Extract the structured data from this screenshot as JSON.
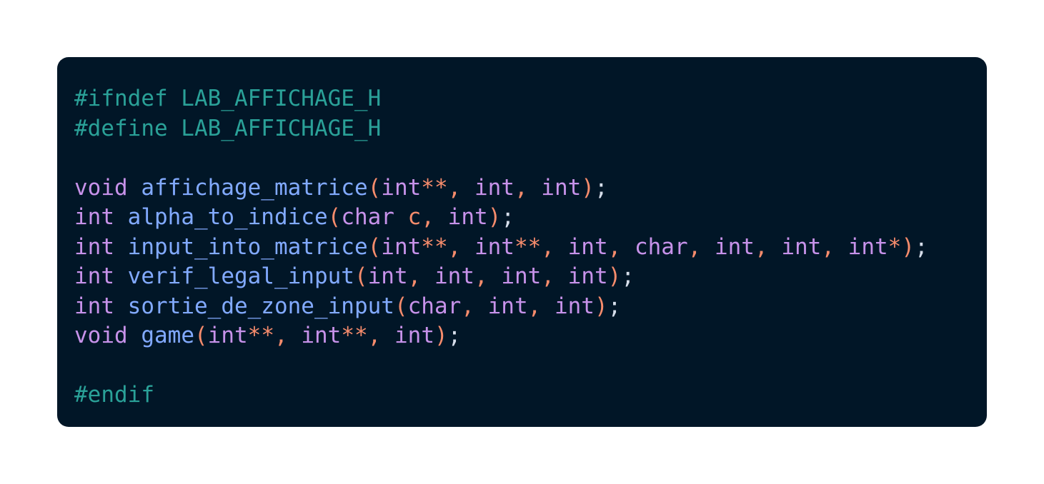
{
  "colors": {
    "page_background": "#ffffff",
    "card_background": "#011627",
    "preprocessor": "#2aa198",
    "keyword": "#c792ea",
    "function": "#82aaff",
    "operator": "#f78c6c",
    "punctuation": "#d6deeb"
  },
  "code": {
    "language": "c",
    "lines": [
      [
        {
          "t": "preproc",
          "v": "#ifndef LAB_AFFICHAGE_H"
        }
      ],
      [
        {
          "t": "preproc",
          "v": "#define LAB_AFFICHAGE_H"
        }
      ],
      [],
      [
        {
          "t": "keyword",
          "v": "void"
        },
        {
          "t": "space",
          "v": " "
        },
        {
          "t": "func",
          "v": "affichage_matrice"
        },
        {
          "t": "paren",
          "v": "("
        },
        {
          "t": "keyword",
          "v": "int"
        },
        {
          "t": "op",
          "v": "**"
        },
        {
          "t": "op",
          "v": ","
        },
        {
          "t": "space",
          "v": " "
        },
        {
          "t": "keyword",
          "v": "int"
        },
        {
          "t": "op",
          "v": ","
        },
        {
          "t": "space",
          "v": " "
        },
        {
          "t": "keyword",
          "v": "int"
        },
        {
          "t": "paren",
          "v": ")"
        },
        {
          "t": "punct",
          "v": ";"
        }
      ],
      [
        {
          "t": "keyword",
          "v": "int"
        },
        {
          "t": "space",
          "v": " "
        },
        {
          "t": "func",
          "v": "alpha_to_indice"
        },
        {
          "t": "paren",
          "v": "("
        },
        {
          "t": "keyword",
          "v": "char"
        },
        {
          "t": "space",
          "v": " "
        },
        {
          "t": "ident",
          "v": "c"
        },
        {
          "t": "op",
          "v": ","
        },
        {
          "t": "space",
          "v": " "
        },
        {
          "t": "keyword",
          "v": "int"
        },
        {
          "t": "paren",
          "v": ")"
        },
        {
          "t": "punct",
          "v": ";"
        }
      ],
      [
        {
          "t": "keyword",
          "v": "int"
        },
        {
          "t": "space",
          "v": " "
        },
        {
          "t": "func",
          "v": "input_into_matrice"
        },
        {
          "t": "paren",
          "v": "("
        },
        {
          "t": "keyword",
          "v": "int"
        },
        {
          "t": "op",
          "v": "**"
        },
        {
          "t": "op",
          "v": ","
        },
        {
          "t": "space",
          "v": " "
        },
        {
          "t": "keyword",
          "v": "int"
        },
        {
          "t": "op",
          "v": "**"
        },
        {
          "t": "op",
          "v": ","
        },
        {
          "t": "space",
          "v": " "
        },
        {
          "t": "keyword",
          "v": "int"
        },
        {
          "t": "op",
          "v": ","
        },
        {
          "t": "space",
          "v": " "
        },
        {
          "t": "keyword",
          "v": "char"
        },
        {
          "t": "op",
          "v": ","
        },
        {
          "t": "space",
          "v": " "
        },
        {
          "t": "keyword",
          "v": "int"
        },
        {
          "t": "op",
          "v": ","
        },
        {
          "t": "space",
          "v": " "
        },
        {
          "t": "keyword",
          "v": "int"
        },
        {
          "t": "op",
          "v": ","
        },
        {
          "t": "space",
          "v": " "
        },
        {
          "t": "keyword",
          "v": "int"
        },
        {
          "t": "op",
          "v": "*"
        },
        {
          "t": "paren",
          "v": ")"
        },
        {
          "t": "punct",
          "v": ";"
        }
      ],
      [
        {
          "t": "keyword",
          "v": "int"
        },
        {
          "t": "space",
          "v": " "
        },
        {
          "t": "func",
          "v": "verif_legal_input"
        },
        {
          "t": "paren",
          "v": "("
        },
        {
          "t": "keyword",
          "v": "int"
        },
        {
          "t": "op",
          "v": ","
        },
        {
          "t": "space",
          "v": " "
        },
        {
          "t": "keyword",
          "v": "int"
        },
        {
          "t": "op",
          "v": ","
        },
        {
          "t": "space",
          "v": " "
        },
        {
          "t": "keyword",
          "v": "int"
        },
        {
          "t": "op",
          "v": ","
        },
        {
          "t": "space",
          "v": " "
        },
        {
          "t": "keyword",
          "v": "int"
        },
        {
          "t": "paren",
          "v": ")"
        },
        {
          "t": "punct",
          "v": ";"
        }
      ],
      [
        {
          "t": "keyword",
          "v": "int"
        },
        {
          "t": "space",
          "v": " "
        },
        {
          "t": "func",
          "v": "sortie_de_zone_input"
        },
        {
          "t": "paren",
          "v": "("
        },
        {
          "t": "keyword",
          "v": "char"
        },
        {
          "t": "op",
          "v": ","
        },
        {
          "t": "space",
          "v": " "
        },
        {
          "t": "keyword",
          "v": "int"
        },
        {
          "t": "op",
          "v": ","
        },
        {
          "t": "space",
          "v": " "
        },
        {
          "t": "keyword",
          "v": "int"
        },
        {
          "t": "paren",
          "v": ")"
        },
        {
          "t": "punct",
          "v": ";"
        }
      ],
      [
        {
          "t": "keyword",
          "v": "void"
        },
        {
          "t": "space",
          "v": " "
        },
        {
          "t": "func",
          "v": "game"
        },
        {
          "t": "paren",
          "v": "("
        },
        {
          "t": "keyword",
          "v": "int"
        },
        {
          "t": "op",
          "v": "**"
        },
        {
          "t": "op",
          "v": ","
        },
        {
          "t": "space",
          "v": " "
        },
        {
          "t": "keyword",
          "v": "int"
        },
        {
          "t": "op",
          "v": "**"
        },
        {
          "t": "op",
          "v": ","
        },
        {
          "t": "space",
          "v": " "
        },
        {
          "t": "keyword",
          "v": "int"
        },
        {
          "t": "paren",
          "v": ")"
        },
        {
          "t": "punct",
          "v": ";"
        }
      ],
      [],
      [
        {
          "t": "preproc",
          "v": "#endif"
        }
      ]
    ]
  }
}
